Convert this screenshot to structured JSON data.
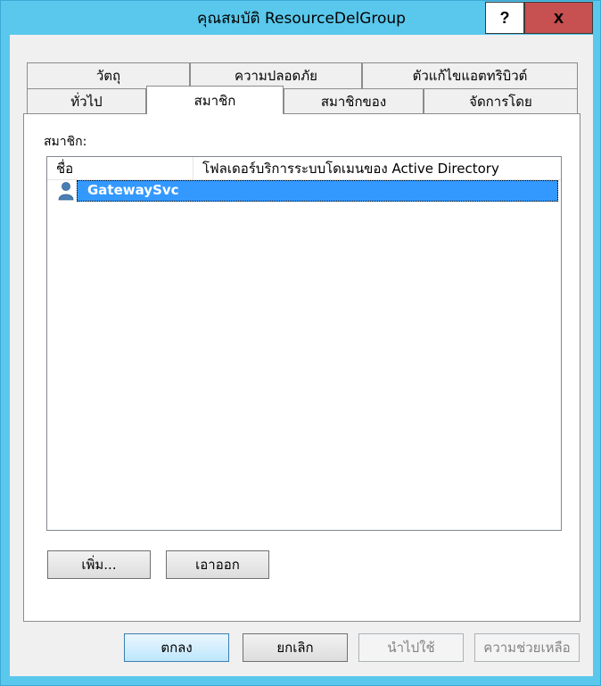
{
  "window": {
    "title": "คุณสมบัติ ResourceDelGroup",
    "help_label": "?",
    "close_label": "x"
  },
  "tabs_top": [
    "วัตถุ",
    "ความปลอดภัย",
    "ตัวแก้ไขแอตทริบิวต์"
  ],
  "tabs_bottom": [
    "ทั่วไป",
    "สมาชิก",
    "สมาชิกของ",
    "จัดการโดย"
  ],
  "active_tab": "สมาชิก",
  "members": {
    "label": "สมาชิก:",
    "columns": [
      "ชื่อ",
      "โฟลเดอร์บริการระบบโดเมนของ Active Directory"
    ],
    "rows": [
      {
        "name": "GatewaySvc",
        "folder": "",
        "icon": "user-icon",
        "selected": true
      }
    ],
    "add_label": "เพิ่ม...",
    "remove_label": "เอาออก"
  },
  "footer": {
    "ok_label": "ตกลง",
    "cancel_label": "ยกเลิก",
    "apply_label": "นำไปใช้",
    "help_label": "ความช่วยเหลือ"
  },
  "colors": {
    "frame": "#5ac8ec",
    "close": "#c75050",
    "selection": "#3399ff"
  }
}
